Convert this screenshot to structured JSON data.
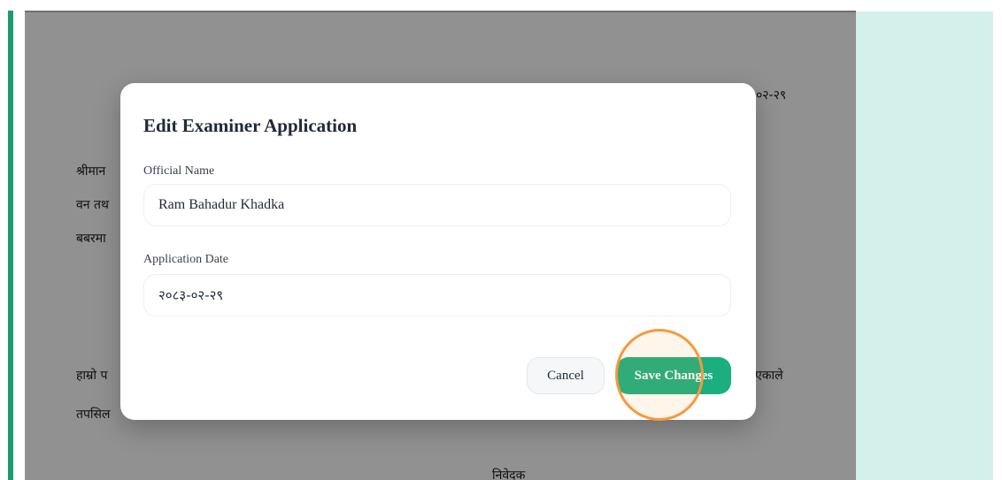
{
  "document": {
    "date_fragment": "०२-२९",
    "line_salutation": "श्रीमान",
    "line_ministry": "वन तथ",
    "line_address": "बबरमा",
    "line_body_start": "हाम्रो प",
    "line_body_end": "एकाले",
    "line_detail": "तपसिल",
    "signatory": "निवेदक"
  },
  "modal": {
    "title": "Edit Examiner Application",
    "official_name_label": "Official Name",
    "official_name_value": "Ram Bahadur Khadka",
    "application_date_label": "Application Date",
    "application_date_value": "२०८३-०२-२९",
    "cancel_label": "Cancel",
    "save_label": "Save Changes"
  },
  "colors": {
    "accent": "#1bae7f",
    "side_strip": "#1e9b6a",
    "right_panel": "#d3f1ea",
    "click_indicator": "#f59a3c"
  }
}
